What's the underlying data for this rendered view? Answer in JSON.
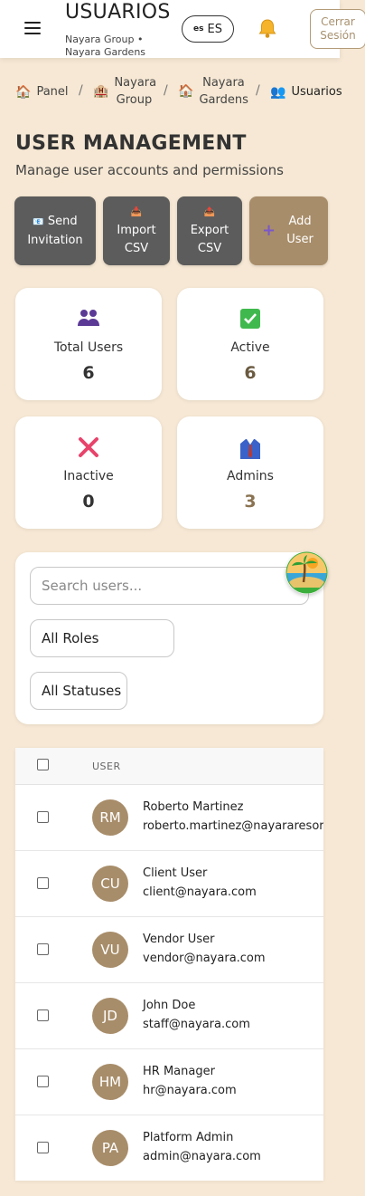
{
  "header": {
    "title": "USUARIOS",
    "subtitle": "Nayara Group • Nayara Gardens",
    "lang_code": "ES",
    "lang_flag": "es",
    "logout_label": "Cerrar Sesión"
  },
  "breadcrumb": [
    {
      "label": "Panel",
      "icon": "house-icon"
    },
    {
      "label": "Nayara Group",
      "icon": "hotel-icon"
    },
    {
      "label": "Nayara Gardens",
      "icon": "house-icon"
    },
    {
      "label": "Usuarios",
      "icon": "users-icon"
    }
  ],
  "breadcrumb_separator": "/",
  "page": {
    "title": "USER MANAGEMENT",
    "description": "Manage user accounts and permissions"
  },
  "actions": {
    "send_invitation": "Send Invitation",
    "import_csv": "Import CSV",
    "export_csv": "Export CSV",
    "add_user": "Add User"
  },
  "stats": [
    {
      "label": "Total Users",
      "value": "6",
      "icon": "users-icon"
    },
    {
      "label": "Active",
      "value": "6",
      "icon": "check-icon"
    },
    {
      "label": "Inactive",
      "value": "0",
      "icon": "x-icon"
    },
    {
      "label": "Admins",
      "value": "3",
      "icon": "suit-icon"
    }
  ],
  "filters": {
    "search_placeholder": "Search users...",
    "role_selected": "All Roles",
    "status_selected": "All Statuses"
  },
  "table": {
    "column_user": "USER",
    "rows": [
      {
        "initials": "RM",
        "name": "Roberto Martinez",
        "email": "roberto.martinez@nayararesorts"
      },
      {
        "initials": "CU",
        "name": "Client User",
        "email": "client@nayara.com"
      },
      {
        "initials": "VU",
        "name": "Vendor User",
        "email": "vendor@nayara.com"
      },
      {
        "initials": "JD",
        "name": "John Doe",
        "email": "staff@nayara.com"
      },
      {
        "initials": "HM",
        "name": "HR Manager",
        "email": "hr@nayara.com"
      },
      {
        "initials": "PA",
        "name": "Platform Admin",
        "email": "admin@nayara.com"
      }
    ]
  },
  "colors": {
    "background": "#f6e8d4",
    "accent": "#a88d6a",
    "dark_button": "#5c5c5c"
  }
}
